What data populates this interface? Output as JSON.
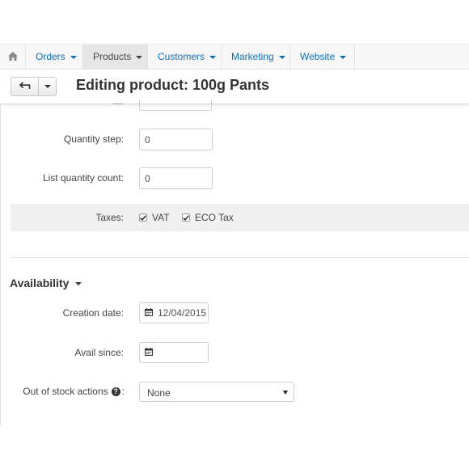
{
  "nav": {
    "items": [
      {
        "label": "Orders"
      },
      {
        "label": "Products"
      },
      {
        "label": "Customers"
      },
      {
        "label": "Marketing"
      },
      {
        "label": "Website"
      }
    ],
    "active": "Products"
  },
  "header": {
    "title": "Editing product: 100g Pants"
  },
  "form": {
    "quantity_step": {
      "label": "Quantity step:",
      "value": "0"
    },
    "list_quantity_count": {
      "label": "List quantity count:",
      "value": "0"
    },
    "taxes": {
      "label": "Taxes:",
      "options": [
        {
          "label": "VAT",
          "checked": true
        },
        {
          "label": "ECO Tax",
          "checked": true
        }
      ]
    }
  },
  "availability": {
    "title": "Availability",
    "creation_date": {
      "label": "Creation date:",
      "value": "12/04/2015"
    },
    "avail_since": {
      "label": "Avail since:",
      "value": ""
    },
    "out_of_stock": {
      "label": "Out of stock actions",
      "colon": ":",
      "value": "None"
    }
  },
  "colors": {
    "link": "#0e6fb7",
    "nav_bg": "#f7f7f7",
    "active_nav_bg": "#e6e6e6",
    "taxes_row_bg": "#f0f0f0"
  }
}
